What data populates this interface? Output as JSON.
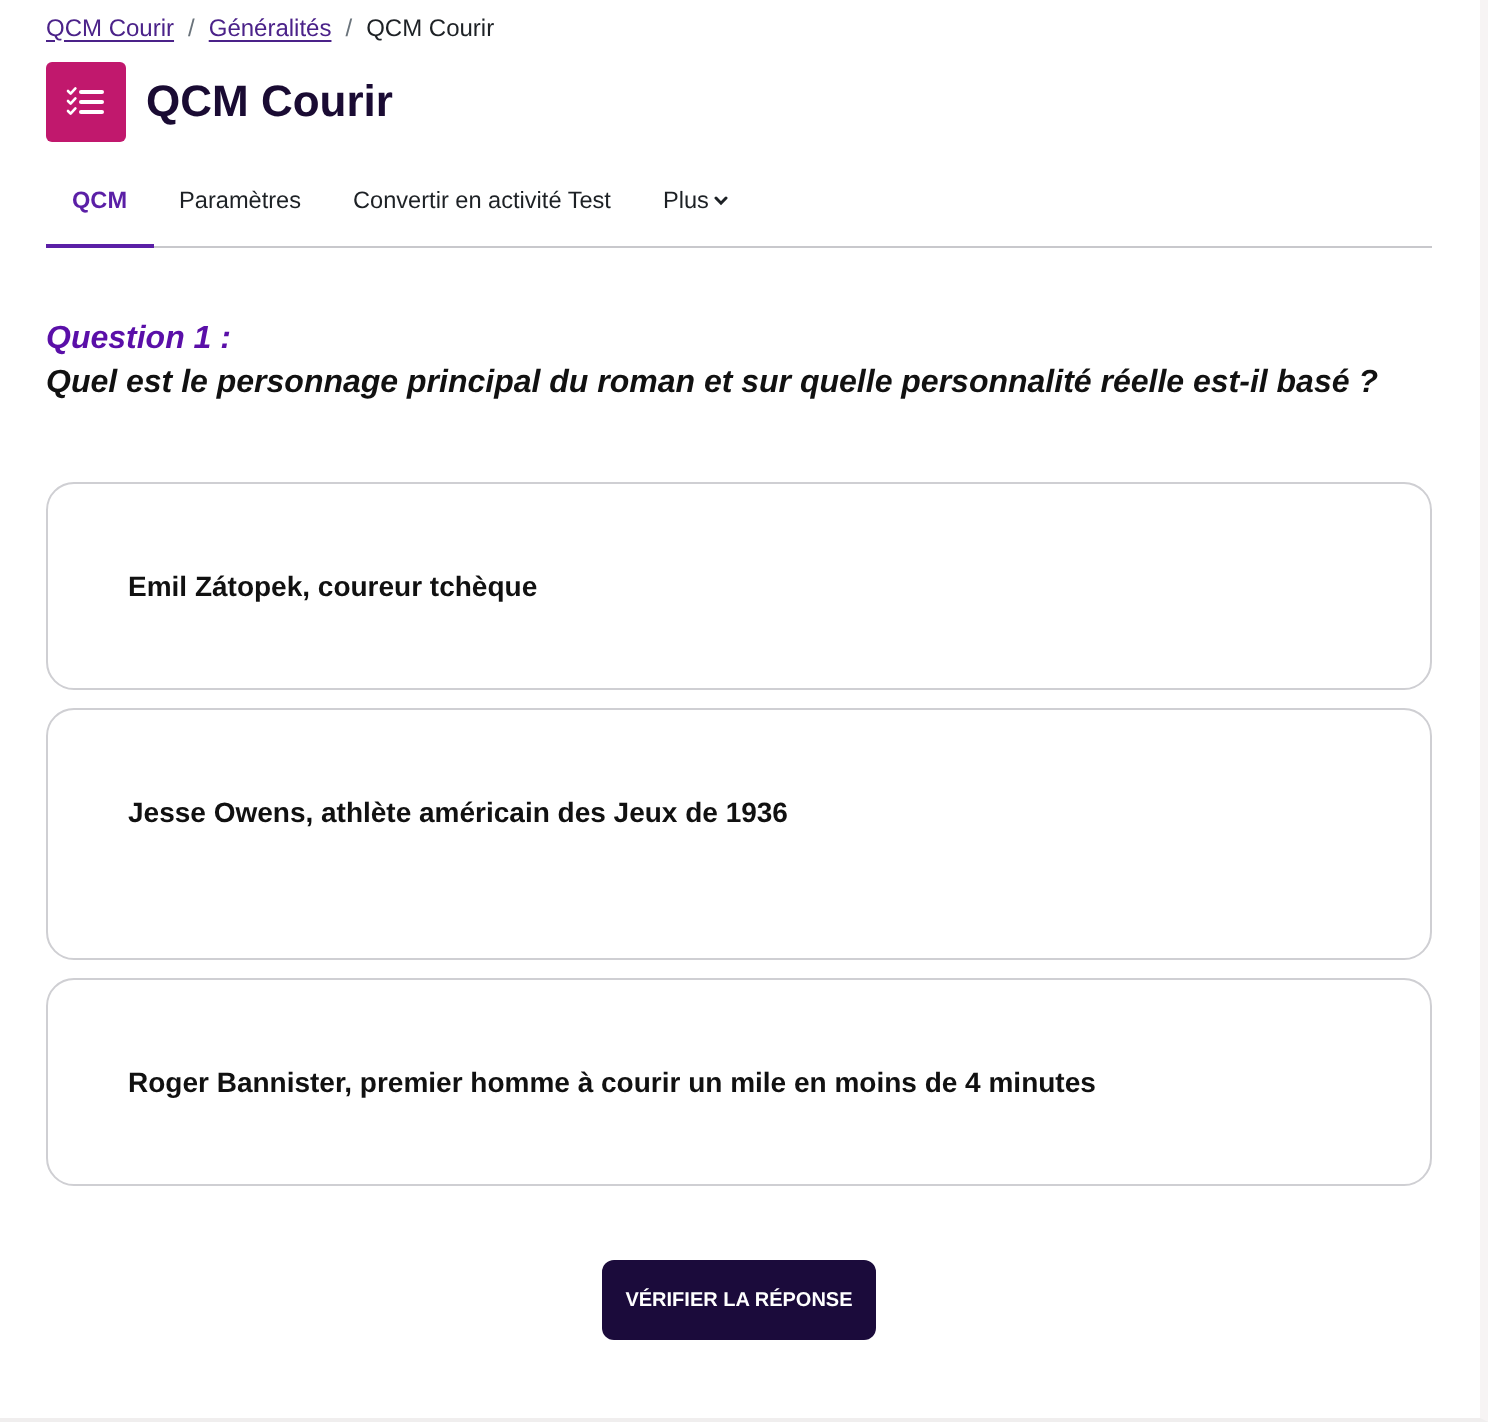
{
  "breadcrumb": [
    {
      "kind": "link",
      "label": "QCM Courir"
    },
    {
      "kind": "separator",
      "label": "/"
    },
    {
      "kind": "link",
      "label": "Généralités"
    },
    {
      "kind": "separator",
      "label": "/"
    },
    {
      "kind": "current",
      "label": "QCM Courir"
    }
  ],
  "header": {
    "title": "QCM Courir"
  },
  "tabs": [
    {
      "label": "QCM",
      "selected": true,
      "dropdown": false
    },
    {
      "label": "Paramètres",
      "selected": false,
      "dropdown": false
    },
    {
      "label": "Convertir en activité Test",
      "selected": false,
      "dropdown": false
    },
    {
      "label": "Plus",
      "selected": false,
      "dropdown": true
    }
  ],
  "question": {
    "label": "Question 1 :",
    "text": "Quel est le personnage principal du roman et sur quelle personnalité réelle est-il basé ?"
  },
  "answers": [
    {
      "text": "Emil Zátopek, coureur tchèque"
    },
    {
      "text": "Jesse Owens, athlète américain des Jeux de 1936"
    },
    {
      "text": "Roger Bannister, premier homme à courir un mile en moins de 4 minutes"
    }
  ],
  "submit_button": {
    "label": "VÉRIFIER LA RÉPONSE"
  }
}
